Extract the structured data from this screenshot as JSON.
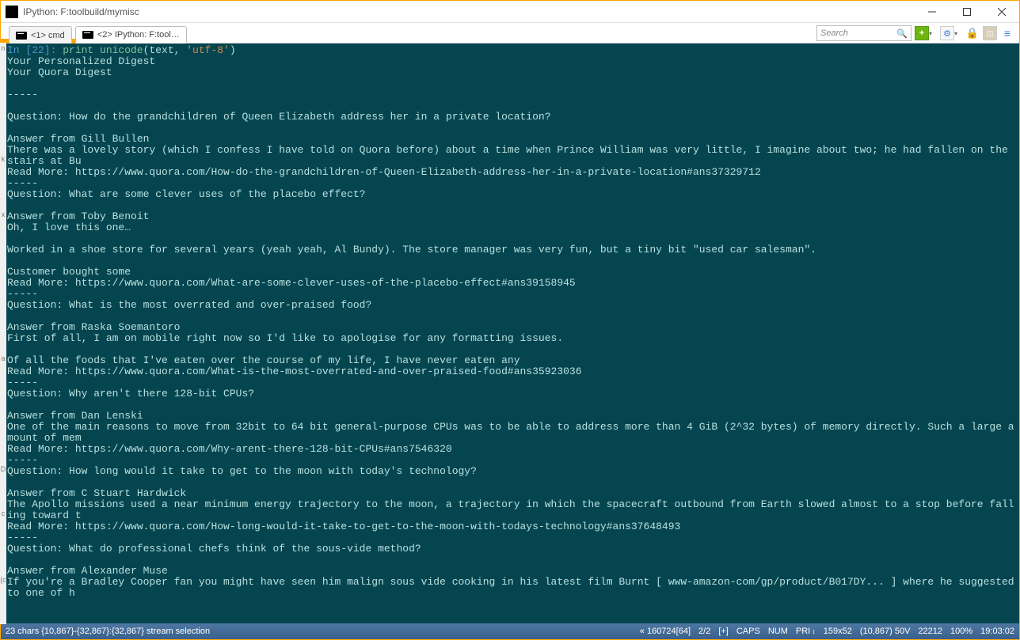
{
  "window": {
    "title": "IPython: F:toolbuild/mymisc"
  },
  "tabs": [
    {
      "label": "<1> cmd",
      "active": false
    },
    {
      "label": "<2> IPython: F:tool…",
      "active": true
    }
  ],
  "search": {
    "placeholder": "Search"
  },
  "terminal": {
    "prompt_in": "In [22]: ",
    "prompt_cmd": "print unicode",
    "prompt_args_open": "(text, ",
    "prompt_str": "'utf-8'",
    "prompt_args_close": ")",
    "lines": [
      "Your Personalized Digest",
      "Your Quora Digest",
      "",
      "-----",
      "",
      "Question: How do the grandchildren of Queen Elizabeth address her in a private location?",
      "",
      "Answer from Gill Bullen",
      "There was a lovely story (which I confess I have told on Quora before) about a time when Prince William was very little, I imagine about two; he had fallen on the stairs at Bu",
      "Read More: https://www.quora.com/How-do-the-grandchildren-of-Queen-Elizabeth-address-her-in-a-private-location#ans37329712",
      "-----",
      "Question: What are some clever uses of the placebo effect?",
      "",
      "Answer from Toby Benoit",
      "Oh, I love this one…",
      "",
      "Worked in a shoe store for several years (yeah yeah, Al Bundy). The store manager was very fun, but a tiny bit \"used car salesman\".",
      "",
      "Customer bought some",
      "Read More: https://www.quora.com/What-are-some-clever-uses-of-the-placebo-effect#ans39158945",
      "-----",
      "Question: What is the most overrated and over-praised food?",
      "",
      "Answer from Raska Soemantoro",
      "First of all, I am on mobile right now so I'd like to apologise for any formatting issues.",
      "",
      "Of all the foods that I've eaten over the course of my life, I have never eaten any",
      "Read More: https://www.quora.com/What-is-the-most-overrated-and-over-praised-food#ans35923036",
      "-----",
      "Question: Why aren't there 128-bit CPUs?",
      "",
      "Answer from Dan Lenski",
      "One of the main reasons to move from 32bit to 64 bit general-purpose CPUs was to be able to address more than 4 GiB (2^32 bytes) of memory directly. Such a large amount of mem",
      "Read More: https://www.quora.com/Why-arent-there-128-bit-CPUs#ans7546320",
      "-----",
      "Question: How long would it take to get to the moon with today's technology?",
      "",
      "Answer from C Stuart Hardwick",
      "The Apollo missions used a near minimum energy trajectory to the moon, a trajectory in which the spacecraft outbound from Earth slowed almost to a stop before falling toward t",
      "Read More: https://www.quora.com/How-long-would-it-take-to-get-to-the-moon-with-todays-technology#ans37648493",
      "-----",
      "Question: What do professional chefs think of the sous-vide method?",
      "",
      "Answer from Alexander Muse",
      "If you're a Bradley Cooper fan you might have seen him malign sous vide cooking in his latest film Burnt [ www-amazon-com/gp/product/B017DY... ] where he suggested to one of h"
    ]
  },
  "left_strip": [
    "n",
    "",
    "",
    "",
    "",
    "",
    "",
    "",
    "",
    "",
    "k",
    "",
    "",
    "",
    "",
    "x",
    "",
    "",
    "",
    "",
    "",
    "",
    "",
    "",
    "",
    "",
    "",
    "",
    "a",
    "",
    "",
    "",
    "",
    "",
    "",
    "",
    "",
    "",
    "D",
    "",
    "",
    "",
    "c",
    "",
    "",
    "",
    "",
    "",
    "(c"
  ],
  "statusbar": {
    "left": "23 chars {10,867}-{32,867}:{32,867} stream selection",
    "cursor": "« 160724[64]",
    "page": "2/2",
    "plus": "[+]",
    "caps": "CAPS",
    "num": "NUM",
    "pri": "PRI",
    "size": "159x52",
    "pos": "(10,867) 50V",
    "pid": "22212",
    "zoom": "100%",
    "time": "19:03:02"
  }
}
